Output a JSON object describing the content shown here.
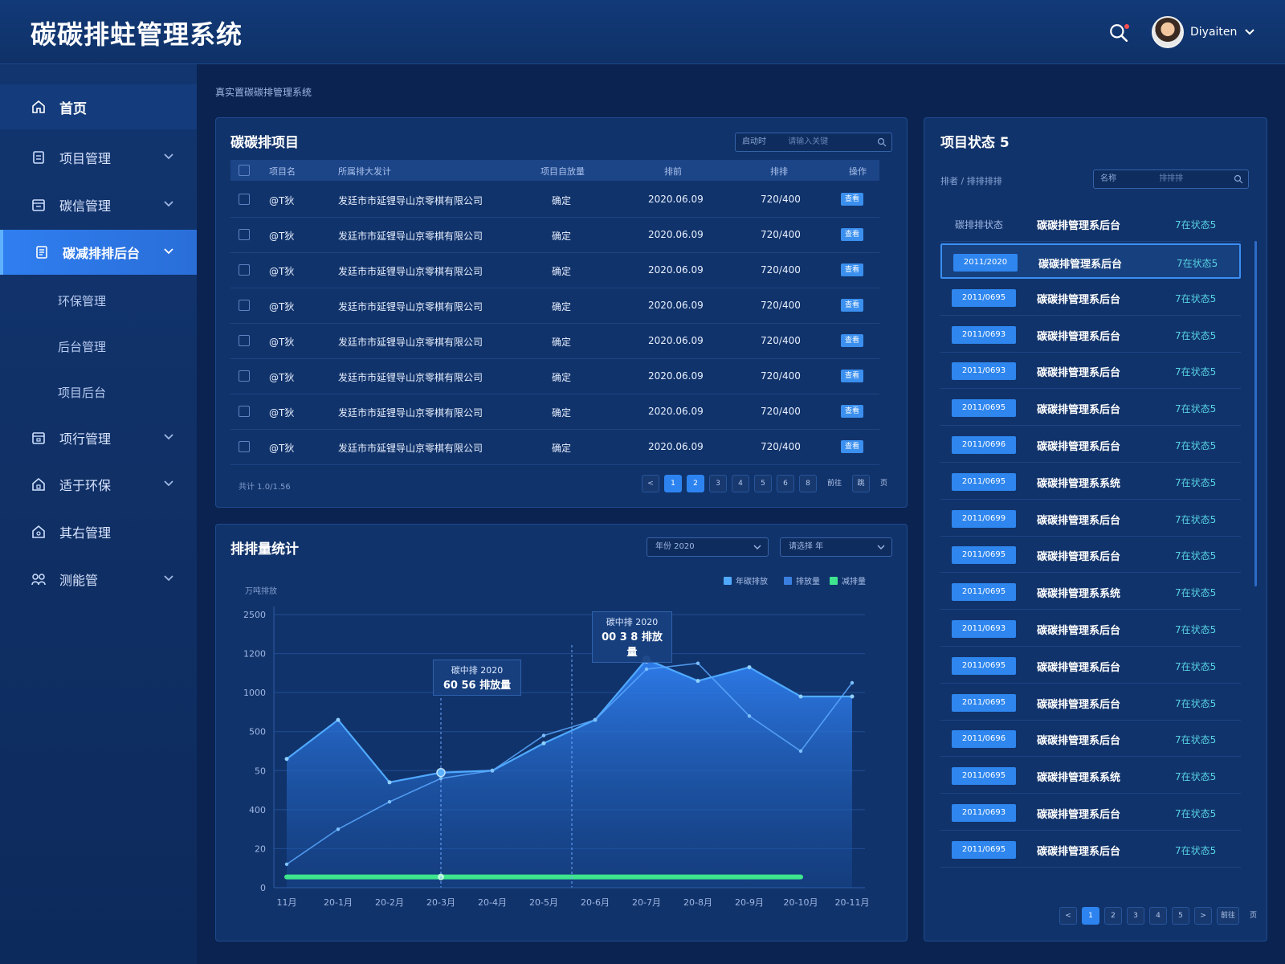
{
  "header": {
    "title": "碳碳排蛀管理系统",
    "user_name": "Diyaiten"
  },
  "sidebar": {
    "home": "首页",
    "items": [
      {
        "label": "项目管理",
        "icon": "document-icon"
      },
      {
        "label": "碳信管理",
        "icon": "calendar-icon"
      },
      {
        "label": "碳减排排后台",
        "icon": "ledger-icon"
      },
      {
        "label": "项行管理",
        "icon": "archive-icon"
      },
      {
        "label": "适于环保",
        "icon": "home-lock-icon"
      },
      {
        "label": "其右管理",
        "icon": "house-icon"
      },
      {
        "label": "测能管",
        "icon": "group-icon"
      }
    ],
    "sub_items": [
      "环保管理",
      "后台管理",
      "项目后台"
    ]
  },
  "breadcrumb": "真实置碳碳排管理系统",
  "projects": {
    "title": "碳碳排项目",
    "search_placeholder": "启动时",
    "search_value": "请输入关键",
    "columns": [
      "项目名",
      "所属排大发计",
      "项目自放量",
      "排前",
      "排排",
      "操作"
    ],
    "rows": [
      {
        "code": "@T狄",
        "company": "发廷市市延锂导山京零棋有限公司",
        "type": "确定",
        "date": "2020.06.09",
        "amount": "720/400",
        "tag": "查看"
      },
      {
        "code": "@T狄",
        "company": "发廷市市延锂导山京零棋有限公司",
        "type": "确定",
        "date": "2020.06.09",
        "amount": "720/400",
        "tag": "查看"
      },
      {
        "code": "@T狄",
        "company": "发廷市市延锂导山京零棋有限公司",
        "type": "确定",
        "date": "2020.06.09",
        "amount": "720/400",
        "tag": "查看"
      },
      {
        "code": "@T狄",
        "company": "发廷市市延锂导山京零棋有限公司",
        "type": "确定",
        "date": "2020.06.09",
        "amount": "720/400",
        "tag": "查看"
      },
      {
        "code": "@T狄",
        "company": "发廷市市延锂导山京零棋有限公司",
        "type": "确定",
        "date": "2020.06.09",
        "amount": "720/400",
        "tag": "查看"
      },
      {
        "code": "@T狄",
        "company": "发廷市市延锂导山京零棋有限公司",
        "type": "确定",
        "date": "2020.06.09",
        "amount": "720/400",
        "tag": "查看"
      },
      {
        "code": "@T狄",
        "company": "发廷市市延锂导山京零棋有限公司",
        "type": "确定",
        "date": "2020.06.09",
        "amount": "720/400",
        "tag": "查看"
      },
      {
        "code": "@T狄",
        "company": "发廷市市延锂导山京零棋有限公司",
        "type": "确定",
        "date": "2020.06.09",
        "amount": "720/400",
        "tag": "查看"
      }
    ],
    "footer": "共计 1.0/1.56",
    "pager": [
      "<",
      "1",
      "2",
      "3",
      "4",
      "5",
      "6",
      "8",
      "前往",
      "跳",
      "页"
    ]
  },
  "chart_panel": {
    "title": "排排量统计",
    "dropdown1": "年份   2020",
    "dropdown2": "请选择   年",
    "y_unit": "万吨排放",
    "tooltip1": {
      "label": "碳中排 2020",
      "value": "60 56 排放量"
    },
    "tooltip2": {
      "label": "碳中排 2020",
      "value": "00 3 8 排放量"
    }
  },
  "chart_data": {
    "type": "area",
    "categories": [
      "11月",
      "20-1月",
      "20-2月",
      "20-3月",
      "20-4月",
      "20-5月",
      "20-6月",
      "20-7月",
      "20-8月",
      "20-9月",
      "20-10月",
      "20-11月"
    ],
    "x_tick_labels": [
      "11月",
      "20-1月",
      "20-2月",
      "20-3月",
      "20-4月",
      "20-5月",
      "20-6月",
      "20-7月",
      "20-8月",
      "20-9月",
      "20-10月",
      "20-11月"
    ],
    "y_ticks": [
      "0",
      "20",
      "400",
      "50",
      "500",
      "1000",
      "1200",
      "2500"
    ],
    "series": [
      {
        "name": "年碳排放",
        "color": "#4fa9ff",
        "values": [
          660,
          860,
          540,
          590,
          600,
          740,
          860,
          1170,
          1060,
          1130,
          980,
          980
        ]
      },
      {
        "name": "排放量",
        "color": "#3a7fe0",
        "values": [
          120,
          300,
          440,
          560,
          600,
          780,
          860,
          1120,
          1150,
          880,
          700,
          1050
        ]
      },
      {
        "name": "减排量",
        "color": "#3ee58e",
        "values": [
          55,
          55,
          55,
          55,
          55,
          55,
          55,
          55,
          55,
          55,
          55,
          null
        ]
      }
    ],
    "ylim": [
      0,
      1400
    ],
    "grid": true,
    "legend": "top-right"
  },
  "status_panel": {
    "title": "项目状态 5",
    "subtitle": "排者 / 排排排排",
    "search_placeholder": "名称",
    "search_value": "排排排",
    "header_row": {
      "left": "碳排排状态",
      "name": "碳碳排管理系后台",
      "stat": "7在状态5"
    },
    "rows": [
      {
        "badge": "2011/2020",
        "name": "碳碳排管理系后台",
        "stat": "7在状态5"
      },
      {
        "badge": "2011/0695",
        "name": "碳碳排管理系后台",
        "stat": "7在状态5"
      },
      {
        "badge": "2011/0693",
        "name": "碳碳排管理系后台",
        "stat": "7在状态5"
      },
      {
        "badge": "2011/0693",
        "name": "碳碳排管理系后台",
        "stat": "7在状态5"
      },
      {
        "badge": "2011/0695",
        "name": "碳碳排管理系后台",
        "stat": "7在状态5"
      },
      {
        "badge": "2011/0696",
        "name": "碳碳排管理系后台",
        "stat": "7在状态5"
      },
      {
        "badge": "2011/0695",
        "name": "碳碳排管理系系统",
        "stat": "7在状态5"
      },
      {
        "badge": "2011/0699",
        "name": "碳碳排管理系后台",
        "stat": "7在状态5"
      },
      {
        "badge": "2011/0695",
        "name": "碳碳排管理系后台",
        "stat": "7在状态5"
      },
      {
        "badge": "2011/0695",
        "name": "碳碳排管理系系统",
        "stat": "7在状态5"
      },
      {
        "badge": "2011/0693",
        "name": "碳碳排管理系后台",
        "stat": "7在状态5"
      },
      {
        "badge": "2011/0695",
        "name": "碳碳排管理系后台",
        "stat": "7在状态5"
      },
      {
        "badge": "2011/0695",
        "name": "碳碳排管理系后台",
        "stat": "7在状态5"
      },
      {
        "badge": "2011/0696",
        "name": "碳碳排管理系后台",
        "stat": "7在状态5"
      },
      {
        "badge": "2011/0695",
        "name": "碳碳排管理系系统",
        "stat": "7在状态5"
      },
      {
        "badge": "2011/0693",
        "name": "碳碳排管理系后台",
        "stat": "7在状态5"
      },
      {
        "badge": "2011/0695",
        "name": "碳碳排管理系后台",
        "stat": "7在状态5"
      }
    ],
    "pager": [
      "<",
      "1",
      "2",
      "3",
      "4",
      "5",
      ">",
      "前往",
      "页"
    ]
  }
}
